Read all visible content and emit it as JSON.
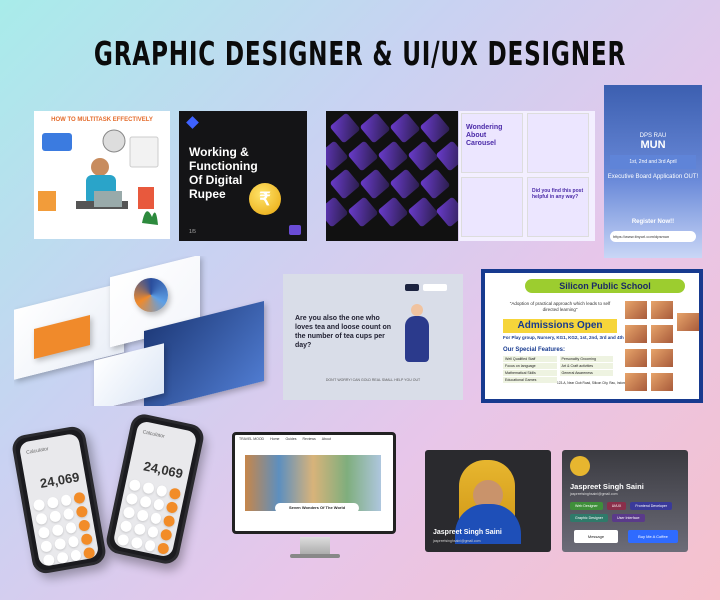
{
  "title": "GRAPHIC DESIGNER & UI/UX DESIGNER",
  "multitask": {
    "heading": "HOW TO MULTITASK EFFECTIVELY"
  },
  "rupee": {
    "title": "Working & Functioning Of Digital Rupee",
    "symbol": "₹",
    "page": "1/5"
  },
  "carousel": {
    "q1": "Wondering About Carousel",
    "q2": "Did you find this post helpful in any way?"
  },
  "mun": {
    "school": "DPS RAU",
    "event": "MUN",
    "dates": "1st, 2nd and 3rd April",
    "desc": "Executive Board Application OUT!",
    "cta": "Register Now!!",
    "url": "https://www.tinyurl.com/dpsmun"
  },
  "tea": {
    "question": "Are you also the one who loves tea and loose count on the number of tea cups per day?",
    "footer": "DON'T WORRY! CAN GOLD REAL SMALL HELP YOU OUT"
  },
  "school": {
    "name": "Silicon Public School",
    "tagline": "\"Adoption of practical approach which leads to self directed learning\"",
    "headline": "Admissions Open",
    "sub": "For Play group, Nursery, KG1, KG2, 1st, 2nd, 3rd and 4th",
    "features_title": "Our Special Features:",
    "features": [
      "Well Qualified Staff",
      "Personality Grooming",
      "Focus on language",
      "Art & Craft activities",
      "Mathematical Skills",
      "",
      "General Awareness",
      "",
      "Educational Games",
      ""
    ],
    "address": "123-A, Near Club Road, Silicon City, Rau, Indore"
  },
  "phones": [
    {
      "label": "Calculator",
      "value": "24,069"
    },
    {
      "label": "Calculator",
      "value": "24,069"
    }
  ],
  "monitor": {
    "brand": "TRAVEL MOOD",
    "nav": [
      "Home",
      "Guides",
      "Reviews",
      "About"
    ],
    "caption": "Seven Wonders Of The World"
  },
  "profile1": {
    "name": "Jaspreet Singh Saini",
    "email": "jaspreetsinghsaini@gmail.com"
  },
  "profile2": {
    "name": "Jaspreet Singh Saini",
    "email": "jaspreetsinghsaini@gmail.com",
    "tags": [
      "Web Designer",
      "UI/UX",
      "Frontend Developer",
      "Graphic Designer",
      "User Interface"
    ],
    "message": "Message",
    "coffee": "Buy Me A Coffee"
  }
}
